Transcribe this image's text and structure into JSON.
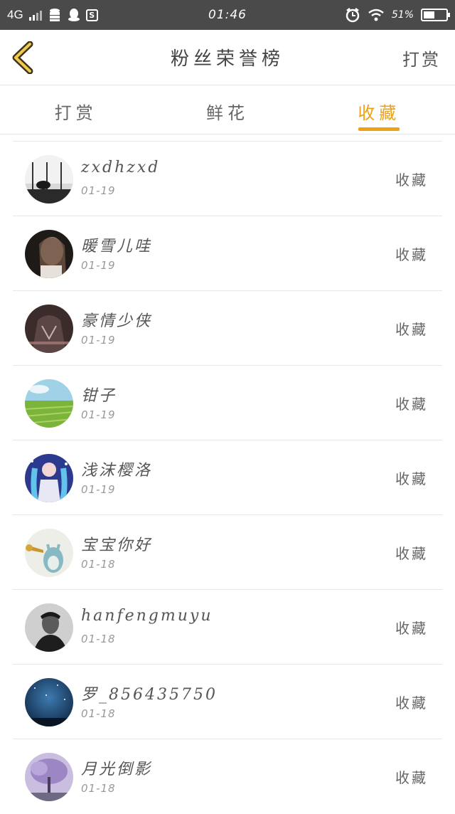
{
  "status_bar": {
    "network": "4G",
    "time": "01:46",
    "battery": "51%",
    "battery_level": 0.51
  },
  "header": {
    "title": "粉丝荣誉榜",
    "action_label": "打赏"
  },
  "tabs": [
    {
      "label": "打赏",
      "active": false
    },
    {
      "label": "鲜花",
      "active": false
    },
    {
      "label": "收藏",
      "active": true
    }
  ],
  "colors": {
    "accent": "#f0a010",
    "status_bar": "#4a4a4a"
  },
  "list": [
    {
      "name": "zxdhzxd",
      "date": "01-19",
      "action": "收藏",
      "avatar": "avatar-zxdhzxd"
    },
    {
      "name": "暖雪儿哇",
      "date": "01-19",
      "action": "收藏",
      "avatar": "avatar-nuanxue"
    },
    {
      "name": "豪情少侠",
      "date": "01-19",
      "action": "收藏",
      "avatar": "avatar-haoqing"
    },
    {
      "name": "钳子",
      "date": "01-19",
      "action": "收藏",
      "avatar": "avatar-qianzi"
    },
    {
      "name": "浅沫樱洛",
      "date": "01-19",
      "action": "收藏",
      "avatar": "avatar-qianmo"
    },
    {
      "name": "宝宝你好",
      "date": "01-18",
      "action": "收藏",
      "avatar": "avatar-baobao"
    },
    {
      "name": "hanfengmuyu",
      "date": "01-18",
      "action": "收藏",
      "avatar": "avatar-hanfeng"
    },
    {
      "name": "罗_856435750",
      "date": "01-18",
      "action": "收藏",
      "avatar": "avatar-luo"
    },
    {
      "name": "月光倒影",
      "date": "01-18",
      "action": "收藏",
      "avatar": "avatar-yueguang"
    }
  ]
}
